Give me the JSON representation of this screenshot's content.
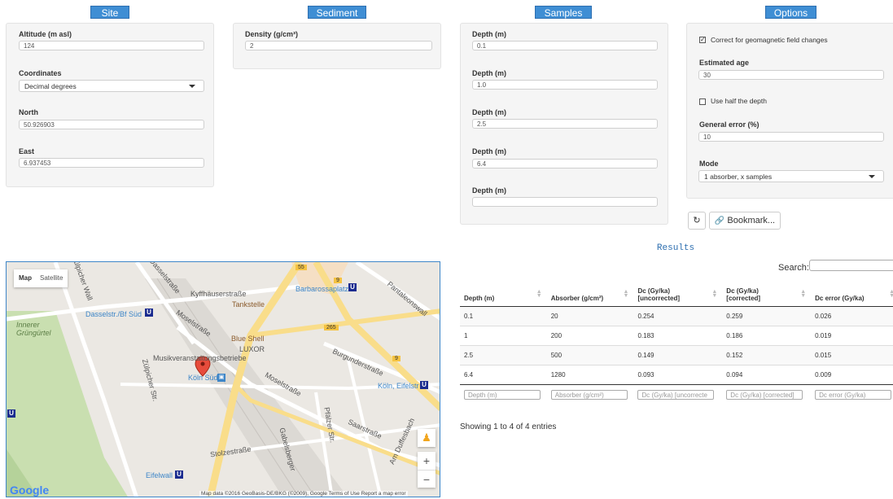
{
  "headers": {
    "site": "Site",
    "sediment": "Sediment",
    "samples": "Samples",
    "options": "Options"
  },
  "site": {
    "altitude_label": "Altitude (m asl)",
    "altitude_value": "124",
    "coordinates_label": "Coordinates",
    "coordinates_value": "Decimal degrees",
    "north_label": "North",
    "north_value": "50.926903",
    "east_label": "East",
    "east_value": "6.937453"
  },
  "sediment": {
    "density_label": "Density (g/cm³)",
    "density_value": "2"
  },
  "samples": {
    "items": [
      {
        "label": "Depth (m)",
        "value": "0.1"
      },
      {
        "label": "Depth (m)",
        "value": "1.0"
      },
      {
        "label": "Depth (m)",
        "value": "2.5"
      },
      {
        "label": "Depth (m)",
        "value": "6.4"
      },
      {
        "label": "Depth (m)",
        "value": ""
      }
    ]
  },
  "options": {
    "geomag_label": "Correct for geomagnetic field changes",
    "geomag_checked": true,
    "age_label": "Estimated age",
    "age_value": "30",
    "half_depth_label": "Use half the depth",
    "half_depth_checked": false,
    "error_label": "General error (%)",
    "error_value": "10",
    "mode_label": "Mode",
    "mode_value": "1 absorber, x samples",
    "refresh_icon": "↻",
    "bookmark_label": "Bookmark..."
  },
  "map": {
    "map_btn": "Map",
    "satellite_btn": "Satellite",
    "labels": {
      "kyffhauser": "Kyffhäuserstraße",
      "tankstelle": "Tankstelle",
      "barbarossa": "Barbarossaplatz",
      "dasselstr": "Dasselstr./Bf Süd",
      "innerer": "Innerer\nGrüngürtel",
      "moselstrasse1": "Moselstraße",
      "blueshell": "Blue Shell",
      "luxor": "LUXOR",
      "musik": "Musikveranstaltungsbetriebe",
      "kolnsud": "Köln Süd",
      "moselstrasse2": "Moselstraße",
      "burgunder": "Burgunderstraße",
      "eifelstr": "Köln, Eifelstr",
      "zulpicher": "Zülpicher Str.",
      "zulpicherwall": "Zülpicher Wall",
      "dassel": "Dasselstraße",
      "pantaleon": "Pantaleonswall",
      "duffesbach": "Am Duffesbach",
      "praelzer": "Pfälzer Str.",
      "saar": "Saarstraße",
      "stolz": "Stolzestraße",
      "gabelsberger": "Gabelsberger",
      "eifelwall": "Eifelwall",
      "b55": "55",
      "b9a": "9",
      "b265": "265",
      "b9b": "9"
    },
    "google": "Google",
    "attribution": "Map data ©2016 GeoBasis-DE/BKG (©2009), Google   Terms of Use   Report a map error",
    "zoom_in": "+",
    "zoom_out": "−"
  },
  "results": {
    "title": "Results",
    "search_label": "Search:",
    "columns": [
      "Depth (m)",
      "Absorber (g/cm²)",
      "Dc (Gy/ka)\n[uncorrected]",
      "Dc (Gy/ka)\n[corrected]",
      "Dc error (Gy/ka)"
    ],
    "rows": [
      [
        "0.1",
        "20",
        "0.254",
        "0.259",
        "0.026"
      ],
      [
        "1",
        "200",
        "0.183",
        "0.186",
        "0.019"
      ],
      [
        "2.5",
        "500",
        "0.149",
        "0.152",
        "0.015"
      ],
      [
        "6.4",
        "1280",
        "0.093",
        "0.094",
        "0.009"
      ]
    ],
    "filters": [
      "Depth (m)",
      "Absorber (g/cm²)",
      "Dc (Gy/ka) [uncorrecte",
      "Dc (Gy/ka) [corrected]",
      "Dc error (Gy/ka)"
    ],
    "footer": "Showing 1 to 4 of 4 entries"
  }
}
